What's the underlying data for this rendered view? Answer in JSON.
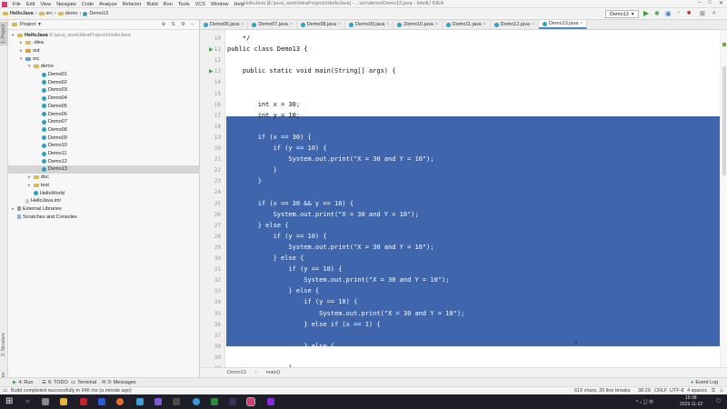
{
  "window": {
    "title": "HelloJava [E:\\java_work\\IdeaProjects\\HelloJava] - ...\\src\\demo\\Demo13.java - IntelliJ IDEA",
    "menu": [
      "File",
      "Edit",
      "View",
      "Navigate",
      "Code",
      "Analyze",
      "Refactor",
      "Build",
      "Run",
      "Tools",
      "VCS",
      "Window",
      "Help"
    ]
  },
  "breadcrumb": [
    "HelloJava",
    "src",
    "demo",
    "Demo13"
  ],
  "run_config": "Demo13",
  "tabs": [
    "Demo06.java",
    "Demo07.java",
    "Demo08.java",
    "Demo09.java",
    "Demo10.java",
    "Demo11.java",
    "Demo12.java",
    "Demo13.java"
  ],
  "active_tab": "Demo13.java",
  "project": {
    "header": "Project",
    "tree": [
      {
        "label": "HelloJava",
        "extra": "E:\\java_work\\IdeaProjects\\HelloJava",
        "kind": "folder",
        "arrow": "▾",
        "bold": true
      },
      {
        "label": ".idea",
        "kind": "folder",
        "arrow": "▸"
      },
      {
        "label": "out",
        "kind": "folder-orange",
        "arrow": "▸"
      },
      {
        "label": "src",
        "kind": "folder-blue",
        "arrow": "▾"
      },
      {
        "label": "demo",
        "kind": "folder",
        "arrow": "▾"
      },
      {
        "label": "Demo01",
        "kind": "class"
      },
      {
        "label": "Demo02",
        "kind": "class"
      },
      {
        "label": "Demo03",
        "kind": "class"
      },
      {
        "label": "Demo04",
        "kind": "class"
      },
      {
        "label": "Demo05",
        "kind": "class"
      },
      {
        "label": "Demo06",
        "kind": "class"
      },
      {
        "label": "Demo07",
        "kind": "class"
      },
      {
        "label": "Demo08",
        "kind": "class"
      },
      {
        "label": "Demo09",
        "kind": "class"
      },
      {
        "label": "Demo10",
        "kind": "class"
      },
      {
        "label": "Demo11",
        "kind": "class"
      },
      {
        "label": "Demo12",
        "kind": "class"
      },
      {
        "label": "Demo13",
        "kind": "class",
        "selected": true
      },
      {
        "label": "doc",
        "kind": "folder",
        "arrow": "▸"
      },
      {
        "label": "test",
        "kind": "folder",
        "arrow": "▸"
      },
      {
        "label": "HelloWorld",
        "kind": "class"
      },
      {
        "label": "HelloJava.iml",
        "kind": "file"
      },
      {
        "label": "External Libraries",
        "kind": "lib",
        "arrow": "▸"
      },
      {
        "label": "Scratches and Consoles",
        "kind": "scratch"
      }
    ]
  },
  "side_labels": {
    "left_top": "1: Project",
    "left_mid": "2: Structure",
    "left_bottom": "2: Favorites"
  },
  "code_lines": [
    {
      "n": "10",
      "text": "    */",
      "sel": false
    },
    {
      "n": "11",
      "text": "public class Demo13 {",
      "sel": false,
      "run": true
    },
    {
      "n": "12",
      "text": "",
      "sel": false
    },
    {
      "n": "13",
      "text": "    public static void main(String[] args) {",
      "sel": false,
      "run": true
    },
    {
      "n": "14",
      "text": "",
      "sel": false
    },
    {
      "n": "15",
      "text": "",
      "sel": false
    },
    {
      "n": "16",
      "text": "        int x = 30;",
      "sel": false
    },
    {
      "n": "17",
      "text": "        int y = 10;",
      "sel": false
    },
    {
      "n": "18",
      "text": "",
      "sel": true
    },
    {
      "n": "19",
      "text": "        if (x == 30) {",
      "sel": true
    },
    {
      "n": "20",
      "text": "            if (y == 10) {",
      "sel": true
    },
    {
      "n": "21",
      "text": "                System.out.print(\"X = 30 and Y = 10\");",
      "sel": true
    },
    {
      "n": "22",
      "text": "            }",
      "sel": true
    },
    {
      "n": "23",
      "text": "        }",
      "sel": true
    },
    {
      "n": "24",
      "text": "",
      "sel": true
    },
    {
      "n": "25",
      "text": "        if (x == 30 && y == 10) {",
      "sel": true
    },
    {
      "n": "26",
      "text": "            System.out.print(\"X = 30 and Y = 10\");",
      "sel": true
    },
    {
      "n": "27",
      "text": "        } else {",
      "sel": true
    },
    {
      "n": "28",
      "text": "            if (y == 10) {",
      "sel": true
    },
    {
      "n": "29",
      "text": "                System.out.print(\"X = 30 and Y = 10\");",
      "sel": true
    },
    {
      "n": "30",
      "text": "            } else {",
      "sel": true
    },
    {
      "n": "31",
      "text": "                if (y == 10) {",
      "sel": true
    },
    {
      "n": "32",
      "text": "                    System.out.print(\"X = 30 and Y = 10\");",
      "sel": true
    },
    {
      "n": "33",
      "text": "                } else {",
      "sel": true
    },
    {
      "n": "34",
      "text": "                    if (y == 10) {",
      "sel": true
    },
    {
      "n": "35",
      "text": "                        System.out.print(\"X = 30 and Y = 10\");",
      "sel": true
    },
    {
      "n": "36",
      "text": "                    } else if (x == 1) {",
      "sel": true
    },
    {
      "n": "37",
      "text": "",
      "sel": true
    },
    {
      "n": "38",
      "text": "                    } else {",
      "sel": true,
      "caret": true
    },
    {
      "n": "39",
      "text": "",
      "sel": false
    },
    {
      "n": "40",
      "text": "                }",
      "sel": false
    }
  ],
  "editor_breadcrumb": [
    "Demo13",
    "main()"
  ],
  "toolwindows": {
    "run": "4: Run",
    "todo": "6: TODO",
    "terminal": "Terminal",
    "messages": "0: Messages",
    "event_log": "Event Log"
  },
  "status": {
    "message": "Build completed successfully in 946 ms (a minute ago)",
    "chars": "619 chars, 20 line breaks",
    "position": "38:29",
    "line_sep": "CRLF",
    "encoding": "UTF-8",
    "indent": "4 spaces"
  },
  "clock": {
    "time": "19:38",
    "date": "2019-11-22"
  }
}
